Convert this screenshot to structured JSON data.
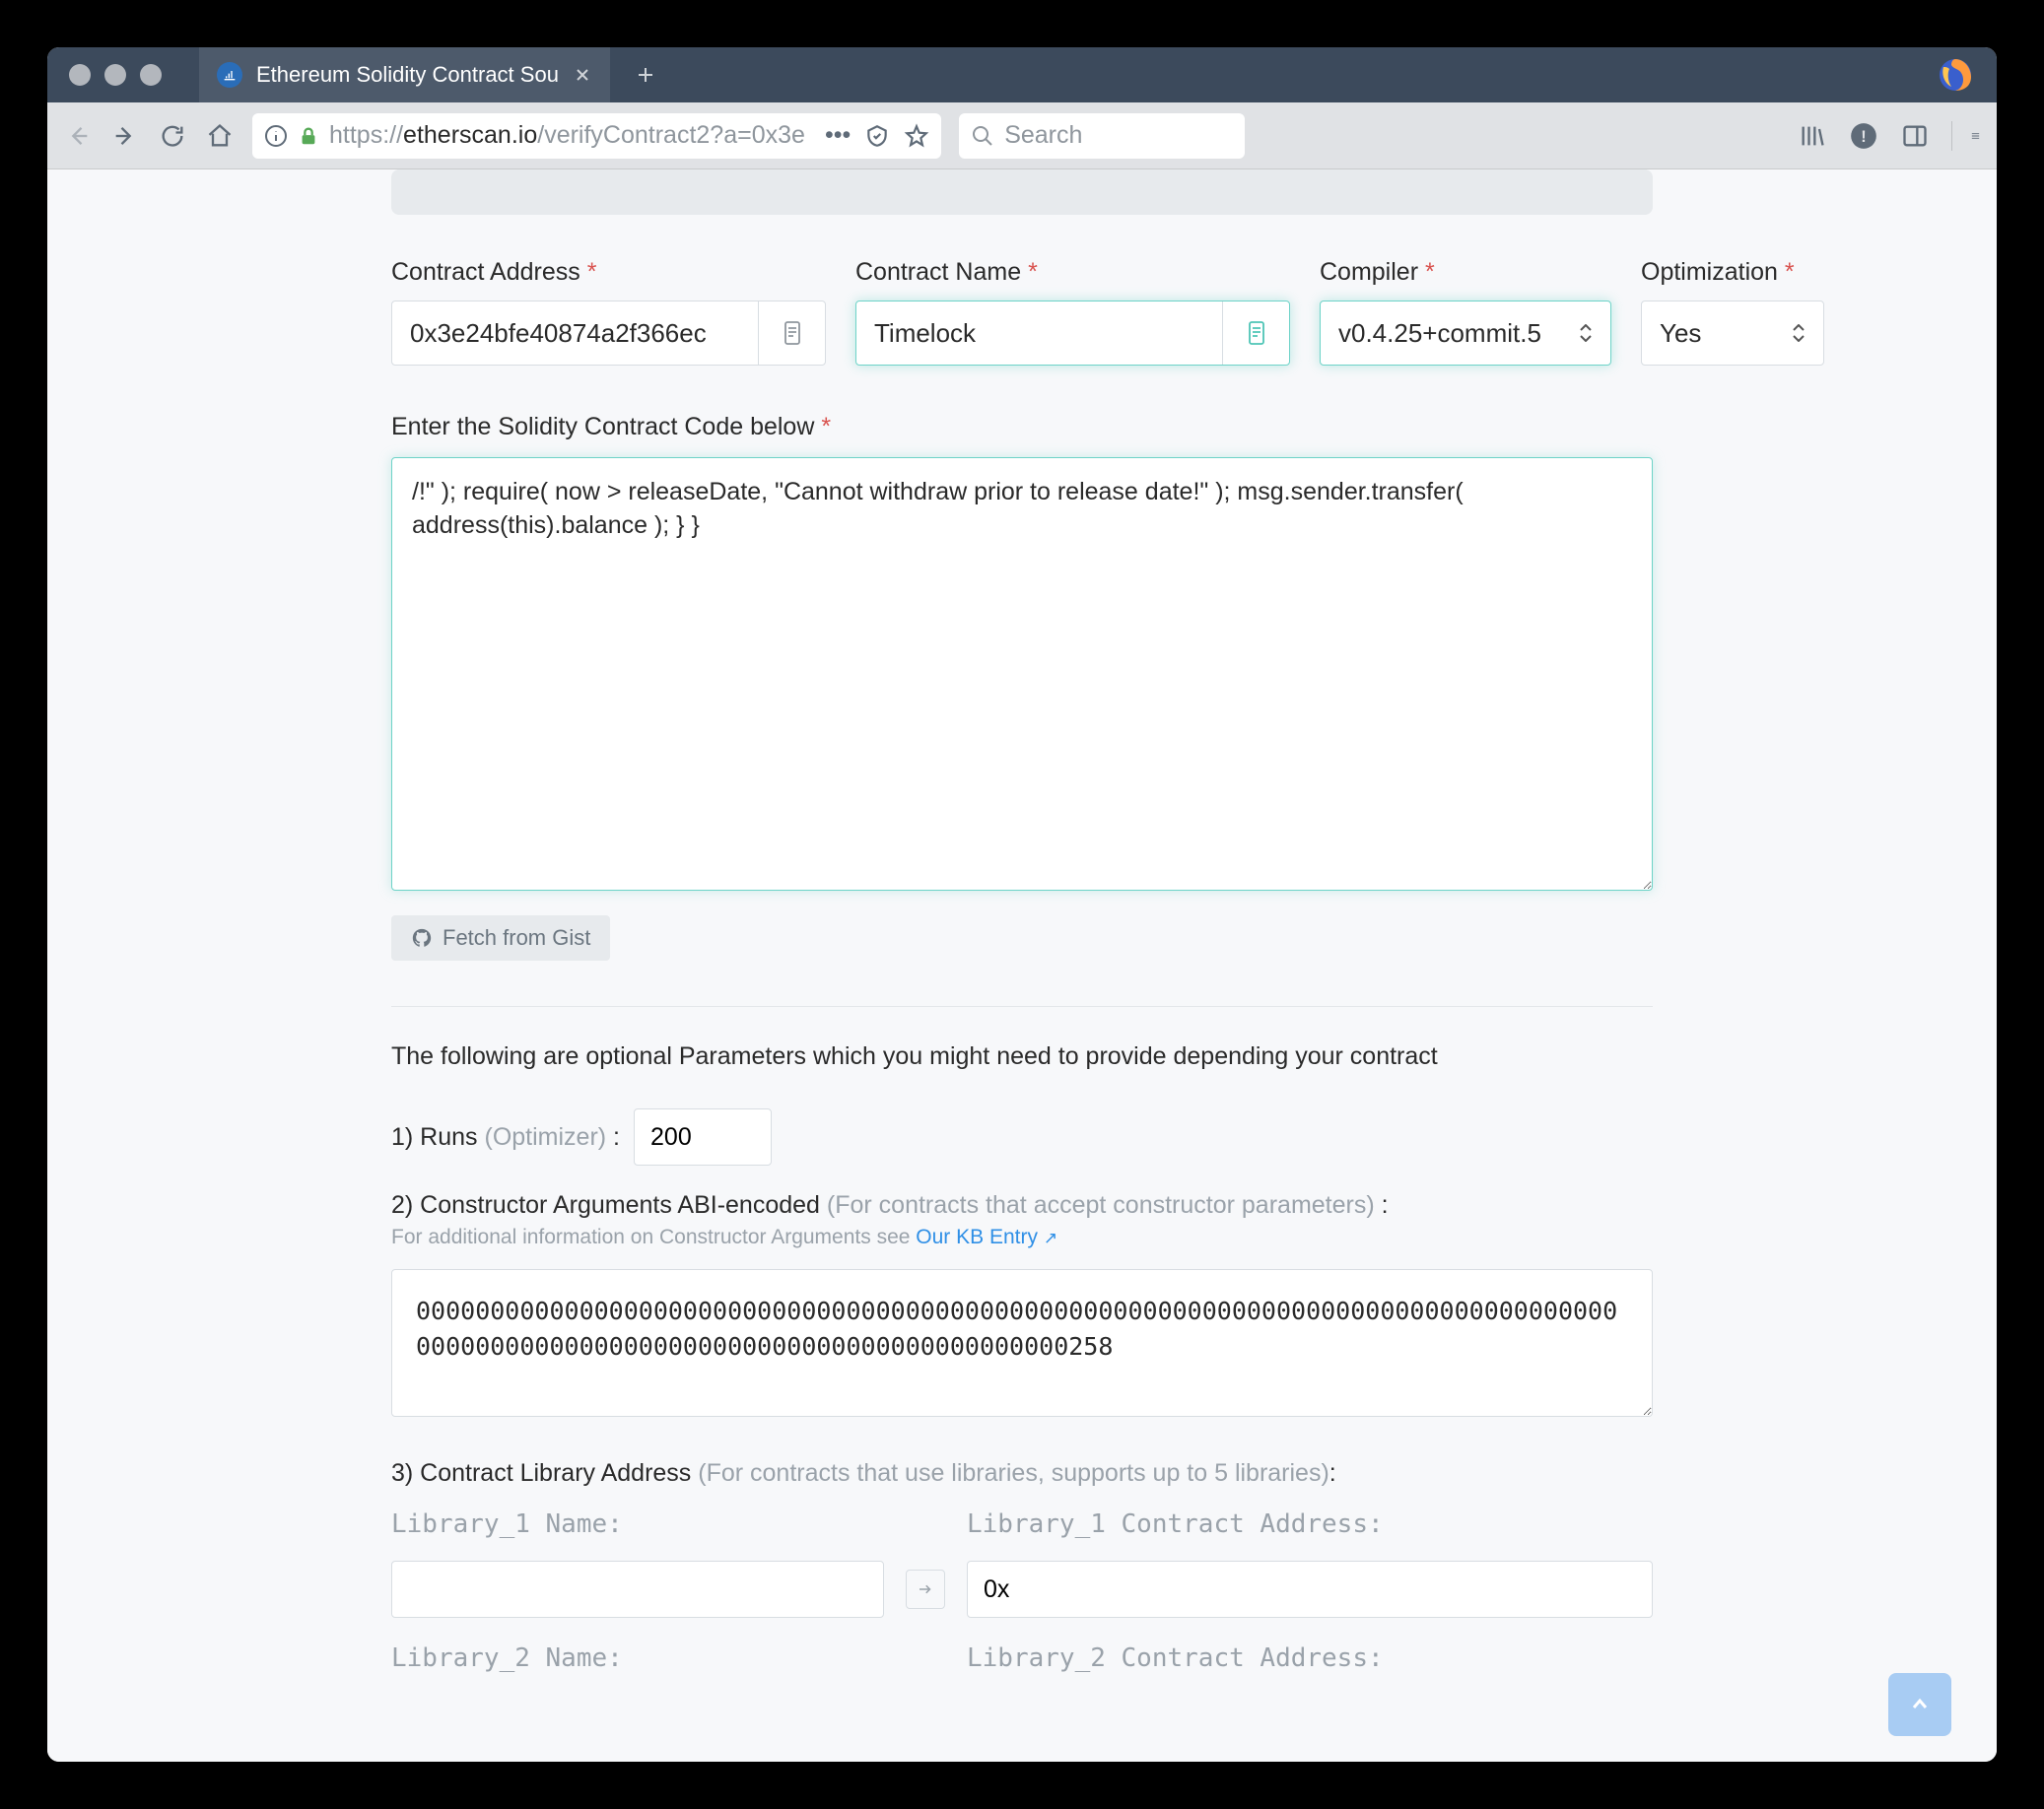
{
  "tab": {
    "title": "Ethereum Solidity Contract Sou"
  },
  "urlbar": {
    "scheme": "https://",
    "host": "etherscan.io",
    "path": "/verifyContract2?a=0x3e"
  },
  "search": {
    "placeholder": "Search"
  },
  "form": {
    "contract_address": {
      "label": "Contract Address",
      "value": "0x3e24bfe40874a2f366ec"
    },
    "contract_name": {
      "label": "Contract Name",
      "value": "Timelock"
    },
    "compiler": {
      "label": "Compiler",
      "value": "v0.4.25+commit.5"
    },
    "optimization": {
      "label": "Optimization",
      "value": "Yes"
    }
  },
  "code": {
    "label": "Enter the Solidity Contract Code below",
    "value": "/!\" ); require( now > releaseDate, \"Cannot withdraw prior to release date!\" ); msg.sender.transfer( address(this).balance ); } }"
  },
  "fetch_gist": "Fetch from Gist",
  "optional_intro": "The following are optional Parameters which you might need to provide depending your contract",
  "runs": {
    "prefix": "1) Runs",
    "note": "(Optimizer)",
    "sep": " :",
    "value": "200"
  },
  "constructor": {
    "prefix": "2) Constructor Arguments ABI-encoded",
    "note": "(For contracts that accept constructor parameters)",
    "sep": " :",
    "info_prefix": "For additional information on Constructor Arguments see ",
    "info_link": "Our KB Entry",
    "value": "00000000000000000000000000000000000000000000000000000000000000000000000000000000000000000000000000000000000000000000000000000258"
  },
  "library_section": {
    "prefix": "3) Contract Library Address",
    "note": "(For contracts that use libraries, supports up to 5 libraries)",
    "sep": ":"
  },
  "libraries": {
    "l1": {
      "name_label": "Library_1 Name:",
      "addr_label": "Library_1 Contract Address:",
      "addr_value": "0x"
    },
    "l2": {
      "name_label": "Library_2 Name:",
      "addr_label": "Library_2 Contract Address:"
    }
  }
}
